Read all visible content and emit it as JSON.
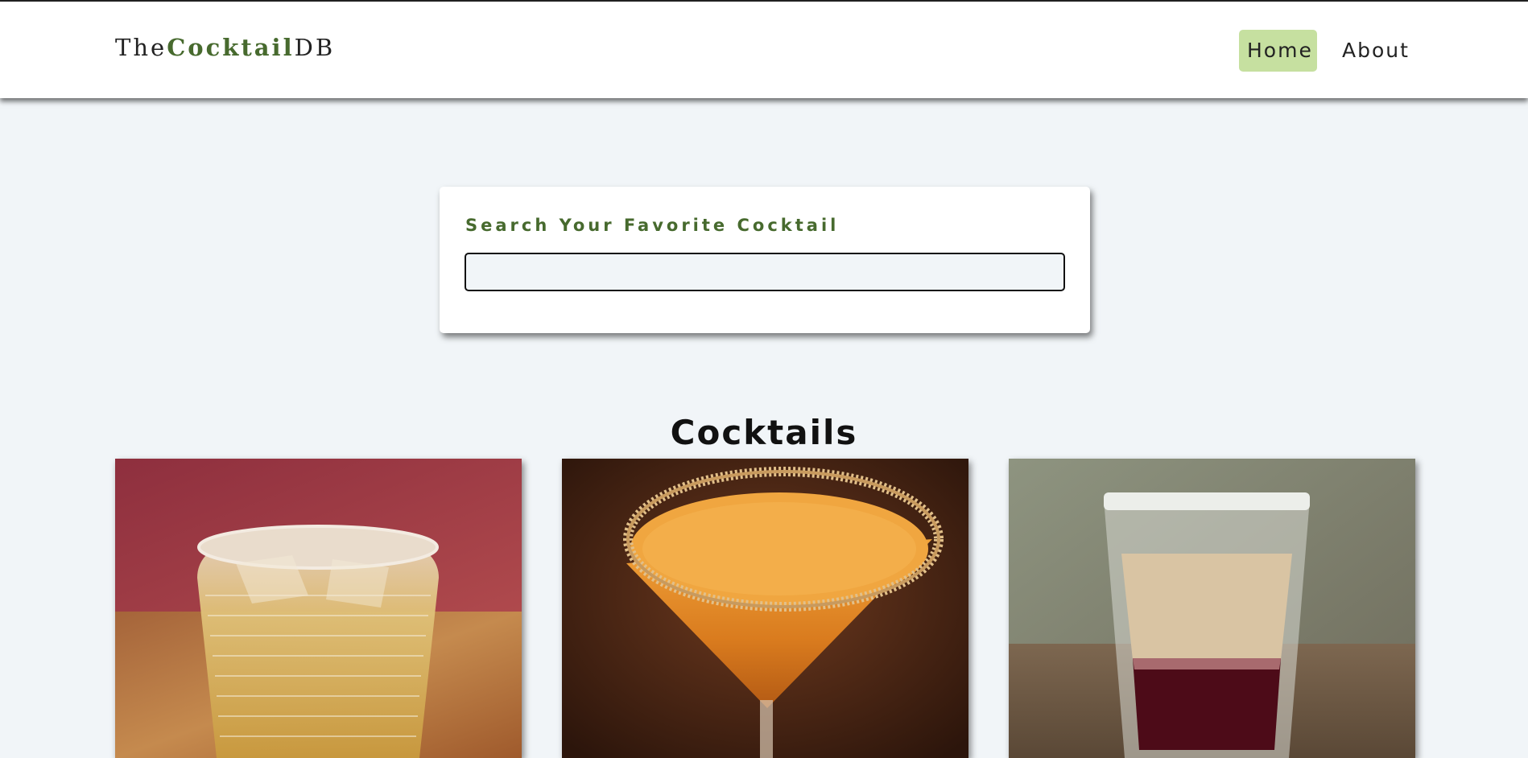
{
  "navbar": {
    "logo_prefix": "The",
    "logo_accent": "Cocktail",
    "logo_suffix": "DB",
    "links": [
      {
        "label": "Home",
        "active": true
      },
      {
        "label": "About",
        "active": false
      }
    ]
  },
  "search": {
    "label": "Search Your Favorite Cocktail",
    "value": "",
    "placeholder": ""
  },
  "section": {
    "title": "Cocktails"
  },
  "cocktails": [
    {
      "image": "whisky-rocks-glass-photo"
    },
    {
      "image": "orange-martini-sugar-rim-photo"
    },
    {
      "image": "layered-shot-glass-photo"
    }
  ],
  "colors": {
    "accent": "#476a2e",
    "active_nav_bg": "#c6e0a0",
    "page_bg": "#f1f5f8"
  }
}
